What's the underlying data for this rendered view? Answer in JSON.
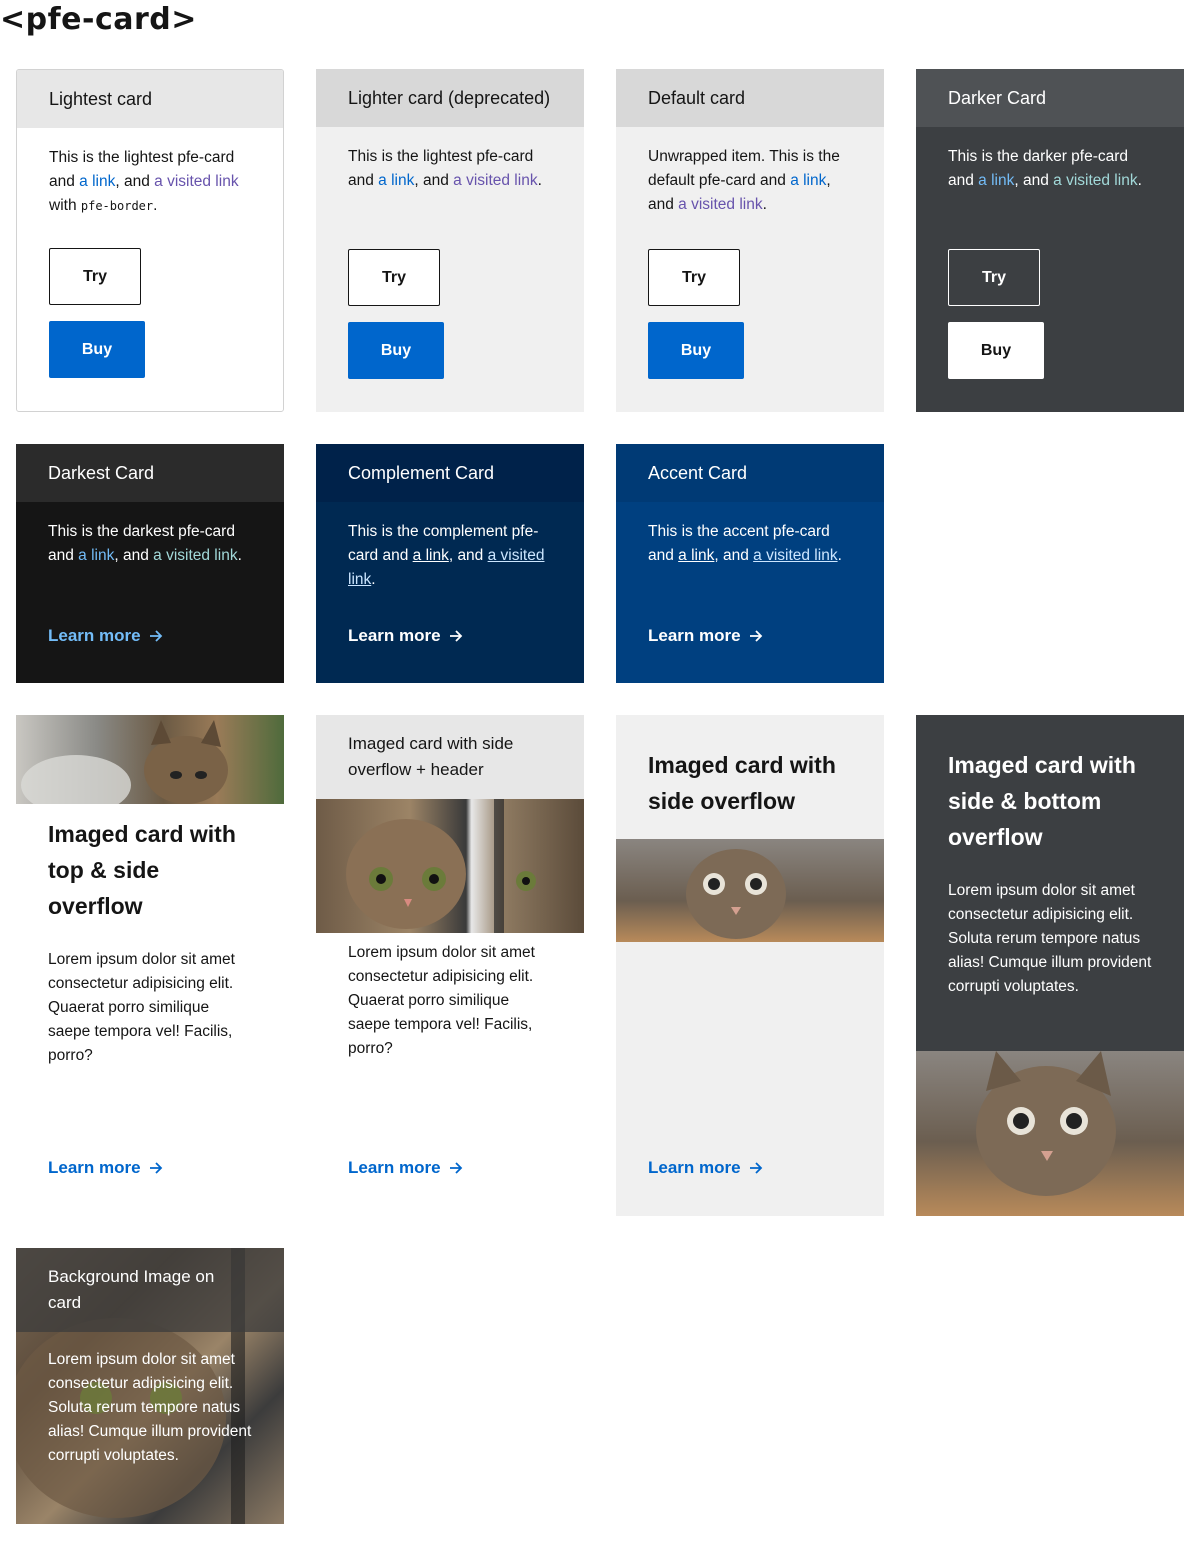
{
  "page_title": "<pfe-card>",
  "cards": {
    "lightest": {
      "header": "Lightest card",
      "body_text1": "This is the lightest pfe-card and ",
      "link": "a link",
      "mid": ", and ",
      "visited": "a visited link",
      "body_text2": " with ",
      "code": "pfe-border",
      "end": ".",
      "try": "Try",
      "buy": "Buy"
    },
    "lighter": {
      "header": "Lighter card (deprecated)",
      "body_text1": "This is the lightest pfe-card and ",
      "link": "a link",
      "mid": ", and ",
      "visited": "a visited link",
      "end": ".",
      "try": "Try",
      "buy": "Buy"
    },
    "default": {
      "header": "Default card",
      "body_text1": "Unwrapped item. This is the default pfe-card and ",
      "link": "a link",
      "mid": ", and ",
      "visited": "a visited link",
      "end": ".",
      "try": "Try",
      "buy": "Buy"
    },
    "darker": {
      "header": "Darker Card",
      "body_text1": "This is the darker pfe-card and ",
      "link": "a link",
      "mid": ", and ",
      "visited": "a visited link",
      "end": ".",
      "try": "Try",
      "buy": "Buy"
    },
    "darkest": {
      "header": "Darkest Card",
      "body_text1": "This is the darkest pfe-card and ",
      "link": "a link",
      "mid": ", and ",
      "visited": "a visited link",
      "end": ".",
      "learn": "Learn more"
    },
    "complement": {
      "header": "Complement Card",
      "body_text1": "This is the complement pfe-card and ",
      "link": "a link",
      "mid": ", and ",
      "visited": "a visited link",
      "end": ".",
      "learn": "Learn more"
    },
    "accent": {
      "header": "Accent Card",
      "body_text1": "This is the accent pfe-card and ",
      "link": "a link",
      "mid": ", and ",
      "visited": "a visited link",
      "end": ".",
      "learn": "Learn more"
    },
    "img_top": {
      "title": "Imaged card with top & side overflow",
      "body": "Lorem ipsum dolor sit amet consectetur adipisicing elit. Quaerat porro similique saepe tempora vel! Facilis, porro?",
      "learn": "Learn more"
    },
    "img_header": {
      "header": "Imaged card with side overflow + header",
      "body": "Lorem ipsum dolor sit amet consectetur adipisicing elit. Quaerat porro similique saepe tempora vel! Facilis, porro?",
      "learn": "Learn more"
    },
    "img_side": {
      "title": "Imaged card with side overflow",
      "learn": "Learn more"
    },
    "img_bottom": {
      "title": "Imaged card with side & bottom overflow",
      "body": "Lorem ipsum dolor sit amet consectetur adipisicing elit. Soluta rerum tempore natus alias! Cumque illum provident corrupti voluptates."
    },
    "bg_image": {
      "header": "Background Image on card",
      "body": "Lorem ipsum dolor sit amet consectetur adipisicing elit. Soluta rerum tempore natus alias! Cumque illum provident corrupti voluptates."
    }
  },
  "colors": {
    "lightest_header": "#e7e7e7",
    "lighter_body": "#f0f0f0",
    "default_header": "#d8d8d8",
    "darker": "#3c3f42",
    "darker_header": "#4f5255",
    "darkest": "#151515",
    "complement": "#002952",
    "accent": "#004080",
    "button_blue": "#0066cc"
  },
  "icons": [
    "arrow-right-icon",
    "kitten-photo"
  ]
}
